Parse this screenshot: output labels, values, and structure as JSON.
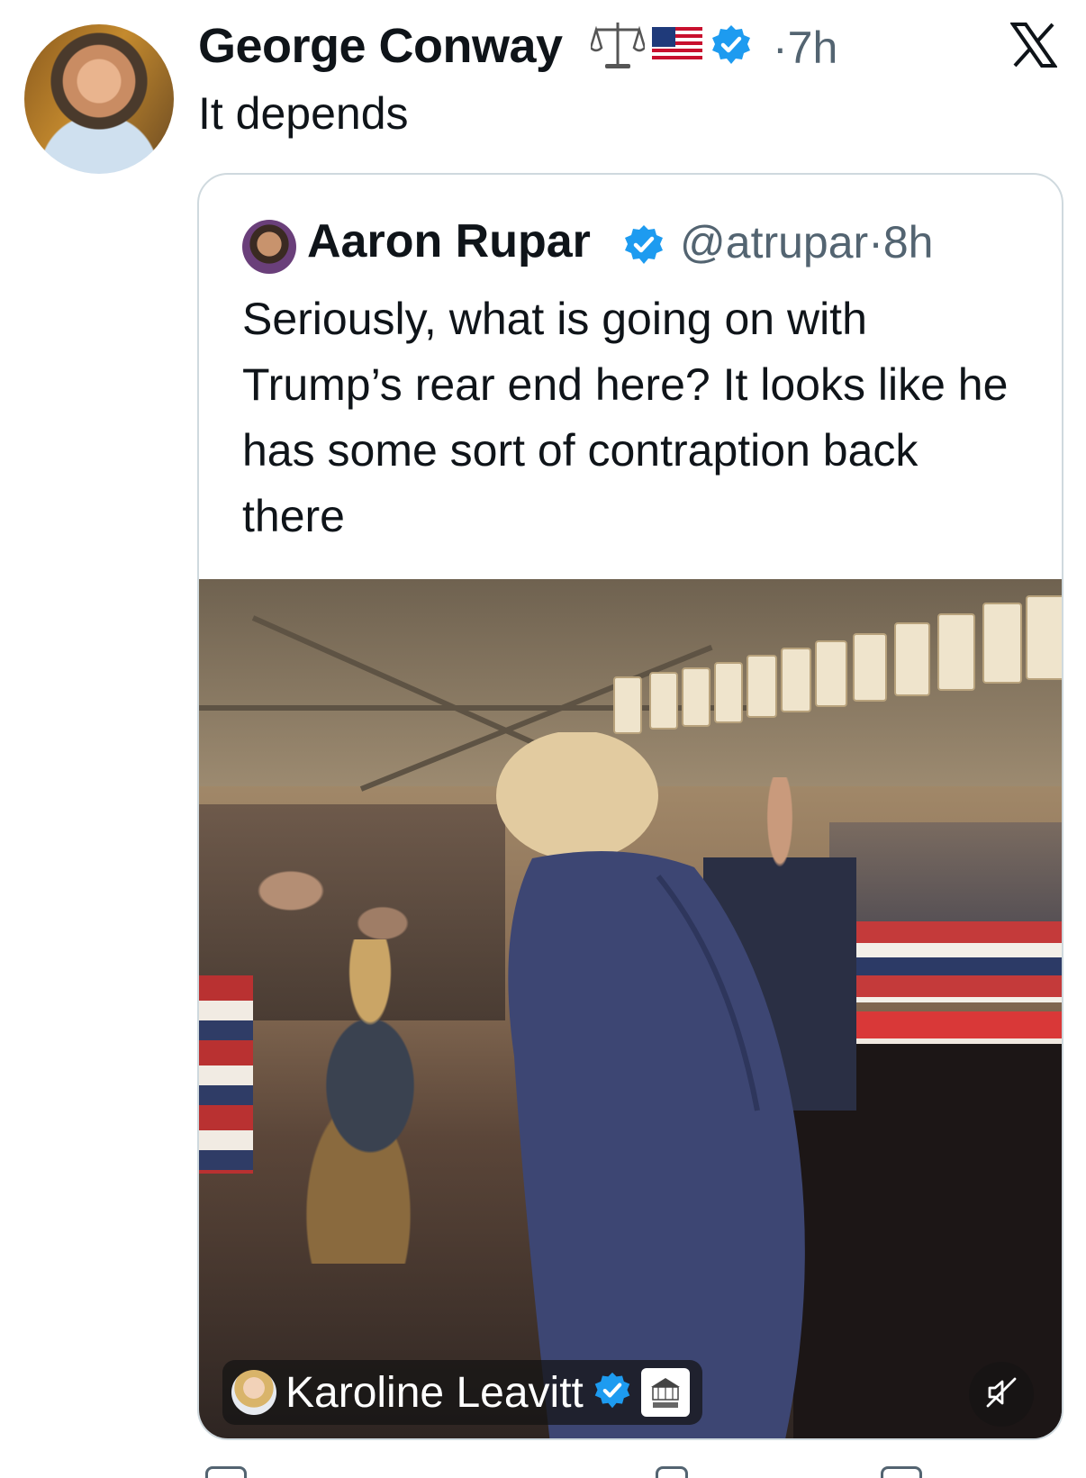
{
  "tweet": {
    "author_name": "George Conway",
    "badge_icons": [
      "scales-icon",
      "us-flag-icon",
      "verified-badge-icon"
    ],
    "separator": "·",
    "time": "7h",
    "text": "It depends"
  },
  "quoted_tweet": {
    "author_name": "Aaron Rupar",
    "handle": "@atrupar",
    "separator": "·",
    "time": "8h",
    "text": "Seriously, what is going on with Trump’s rear end here? It looks like he has some sort of contraption back there"
  },
  "media": {
    "attribution_name": "Karoline Leavitt",
    "attribution_badge_icons": [
      "verified-badge-icon",
      "white-house-logo"
    ],
    "control_icon": "muted-speaker-icon"
  },
  "colors": {
    "text_primary": "#0f1419",
    "text_secondary": "#536471",
    "verified_blue": "#1d9bf0",
    "border": "#cfd9de"
  }
}
